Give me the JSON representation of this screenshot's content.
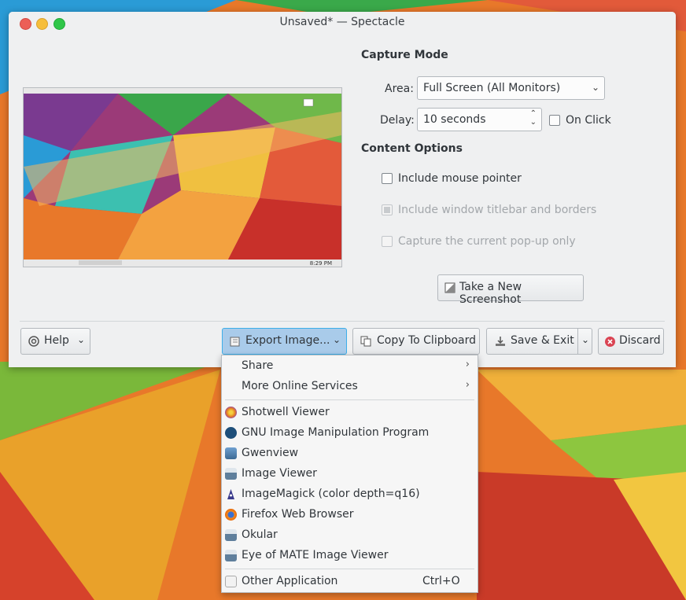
{
  "colors": {
    "window_bg": "#eff0f1",
    "button_active_bg": "#a9cbea",
    "button_active_border": "#3daee9",
    "disabled_text": "#a3a7ab"
  },
  "window": {
    "title": "Unsaved* — Spectacle"
  },
  "capture_mode": {
    "heading": "Capture Mode",
    "area_label": "Area:",
    "area_value": "Full Screen (All Monitors)",
    "delay_label": "Delay:",
    "delay_value": "10 seconds",
    "on_click_label": "On Click",
    "on_click_checked": false
  },
  "content_options": {
    "heading": "Content Options",
    "include_mouse_pointer": {
      "label": "Include mouse pointer",
      "checked": false,
      "enabled": true
    },
    "include_titlebar": {
      "label": "Include window titlebar and borders",
      "checked": true,
      "enabled": false
    },
    "capture_popup_only": {
      "label": "Capture the current pop-up only",
      "checked": false,
      "enabled": false
    }
  },
  "preview": {
    "taskbar_clock": "8:29 PM"
  },
  "buttons": {
    "take_new": "Take a New Screenshot",
    "help": "Help",
    "export": "Export Image...",
    "copy": "Copy To Clipboard",
    "save_exit": "Save & Exit",
    "discard": "Discard"
  },
  "export_menu": {
    "submenus": [
      {
        "label": "Share",
        "icon": "chevron-right-icon"
      },
      {
        "label": "More Online Services",
        "icon": "chevron-right-icon"
      }
    ],
    "apps": [
      {
        "label": "Shotwell Viewer",
        "icon": "shotwell-icon",
        "color": "#e98a2b"
      },
      {
        "label": "GNU Image Manipulation Program",
        "icon": "gimp-icon",
        "color": "#1e4f7a"
      },
      {
        "label": "Gwenview",
        "icon": "gwenview-icon",
        "color": "#4a7aa8"
      },
      {
        "label": "Image Viewer",
        "icon": "image-viewer-icon",
        "color": "#5f7f9c"
      },
      {
        "label": "ImageMagick (color depth=q16)",
        "icon": "imagemagick-icon",
        "color": "#3a3a8c"
      },
      {
        "label": "Firefox Web Browser",
        "icon": "firefox-icon",
        "color": "#e66000"
      },
      {
        "label": "Okular",
        "icon": "okular-icon",
        "color": "#5f7f9c"
      },
      {
        "label": "Eye of MATE Image Viewer",
        "icon": "eye-of-mate-icon",
        "color": "#5f7f9c"
      }
    ],
    "other": {
      "label": "Other Application",
      "shortcut": "Ctrl+O",
      "icon": "other-application-icon"
    }
  }
}
